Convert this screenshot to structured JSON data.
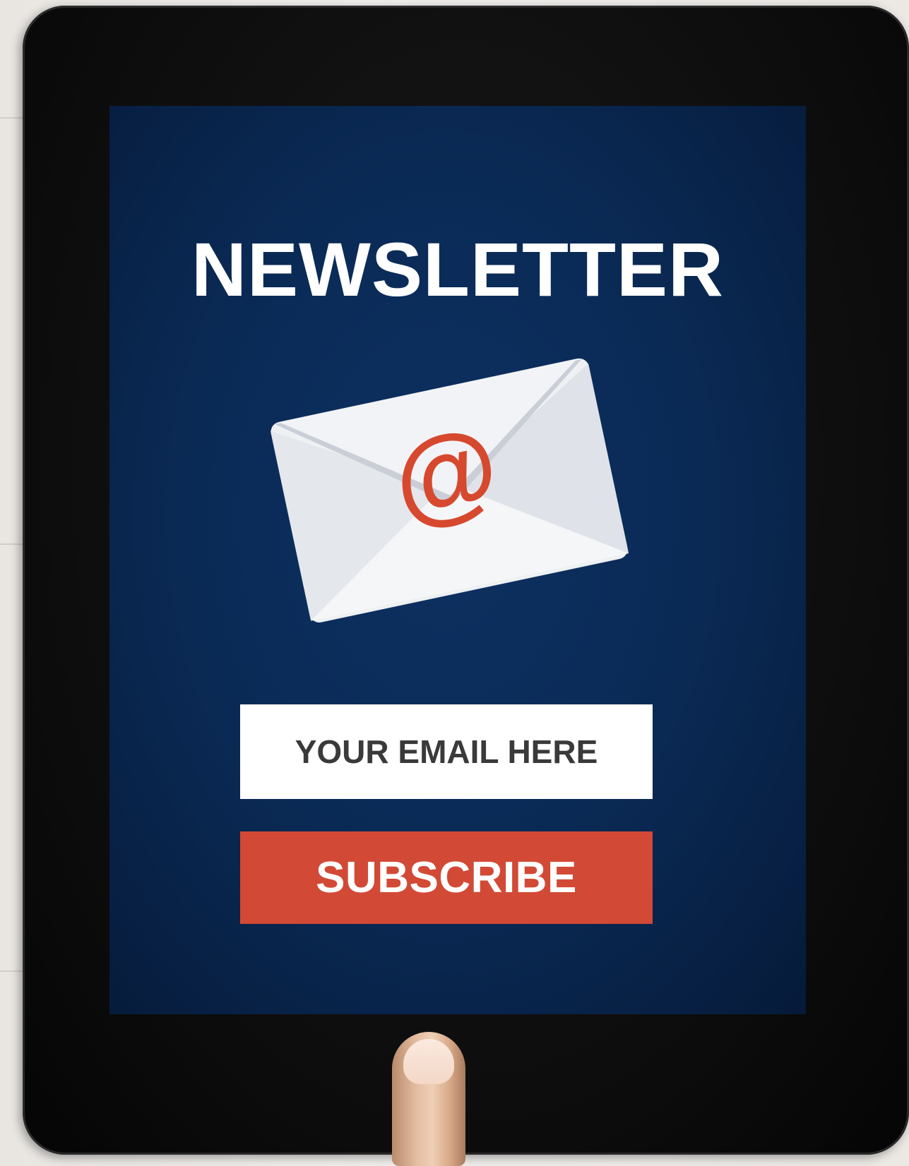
{
  "screen": {
    "title": "NEWSLETTER",
    "email_placeholder": "YOUR EMAIL HERE",
    "subscribe_label": "SUBSCRIBE",
    "icon": "envelope-at-icon"
  },
  "colors": {
    "screen_background": "#0a2a55",
    "button": "#d24a36",
    "at_symbol": "#d6492e",
    "envelope": "#eef0f3"
  }
}
